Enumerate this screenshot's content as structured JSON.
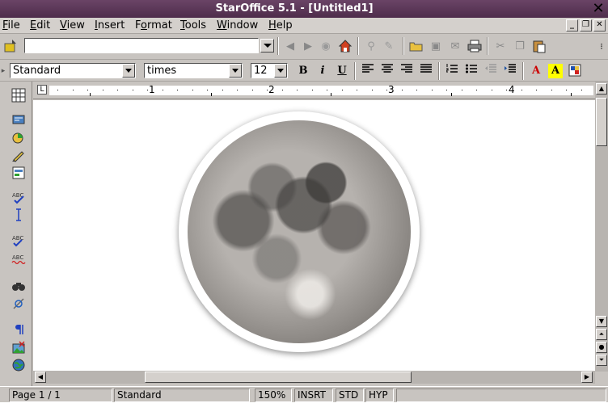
{
  "window": {
    "title": "StarOffice 5.1 - [Untitled1]",
    "close_glyph": "✕"
  },
  "menubar": {
    "items": [
      {
        "pre": "",
        "u": "F",
        "post": "ile"
      },
      {
        "pre": "",
        "u": "E",
        "post": "dit"
      },
      {
        "pre": "",
        "u": "V",
        "post": "iew"
      },
      {
        "pre": "",
        "u": "I",
        "post": "nsert"
      },
      {
        "pre": "F",
        "u": "o",
        "post": "rmat"
      },
      {
        "pre": "",
        "u": "T",
        "post": "ools"
      },
      {
        "pre": "",
        "u": "W",
        "post": "indow"
      },
      {
        "pre": "",
        "u": "H",
        "post": "elp"
      }
    ],
    "win_minimize": "_",
    "win_restore": "❐",
    "win_close": "✕"
  },
  "funcbar": {
    "url_value": ""
  },
  "objbar": {
    "style": "Standard",
    "font": "times",
    "size": "12",
    "bold": "B",
    "italic": "i",
    "underline": "U",
    "font_color": "A",
    "highlight": "A"
  },
  "ruler": {
    "tab_marker": "L",
    "numbers": [
      "1",
      "2",
      "3",
      "4"
    ]
  },
  "statusbar": {
    "page": "Page 1 / 1",
    "style": "Standard",
    "zoom": "150%",
    "mode": "INSRT",
    "selection": "STD",
    "hyperlink": "HYP"
  },
  "colors": {
    "titlebar": "#5e3a5a",
    "chrome": "#c8c4c0",
    "font_color_red": "#cc0000",
    "highlight_yellow": "#ffff00"
  }
}
